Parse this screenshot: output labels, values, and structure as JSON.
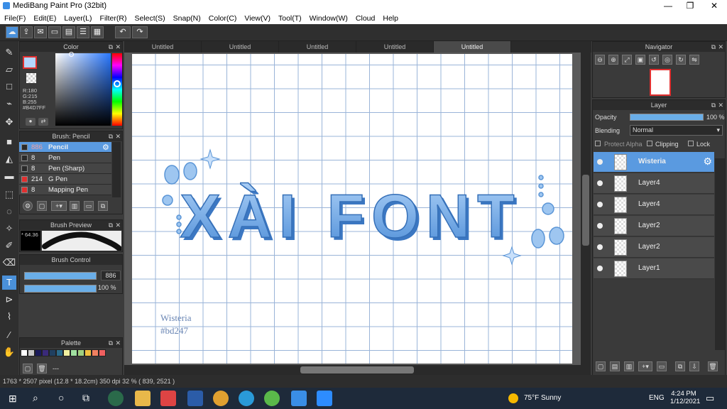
{
  "app": {
    "title": "MediBang Paint Pro (32bit)"
  },
  "window_controls": [
    "—",
    "❐",
    "✕"
  ],
  "menu": [
    "File(F)",
    "Edit(E)",
    "Layer(L)",
    "Filter(R)",
    "Select(S)",
    "Snap(N)",
    "Color(C)",
    "View(V)",
    "Tool(T)",
    "Window(W)",
    "Cloud",
    "Help"
  ],
  "tabs": [
    {
      "label": "Untitled"
    },
    {
      "label": "Untitled"
    },
    {
      "label": "Untitled"
    },
    {
      "label": "Untitled"
    },
    {
      "label": "Untitled",
      "active": true
    }
  ],
  "color_panel": {
    "title": "Color",
    "r": "R:180",
    "g": "G:215",
    "b": "B:255",
    "hex": "#B4D7FF",
    "fg": "#B4D7FF"
  },
  "brush_panel": {
    "title": "Brush: Pencil",
    "items": [
      {
        "size": "886",
        "name": "Pencil",
        "selected": true,
        "swatch": "#2a2a2a"
      },
      {
        "size": "8",
        "name": "Pen",
        "swatch": "#2a2a2a"
      },
      {
        "size": "8",
        "name": "Pen (Sharp)",
        "swatch": "#2a2a2a"
      },
      {
        "size": "214",
        "name": "G Pen",
        "swatch": "#e03030"
      },
      {
        "size": "8",
        "name": "Mapping Pen",
        "swatch": "#e03030"
      }
    ]
  },
  "brush_preview": {
    "title": "Brush Preview",
    "size_label": "* 64.36"
  },
  "brush_control": {
    "title": "Brush Control",
    "size": "886",
    "opacity": "100 %"
  },
  "palette": {
    "title": "Palette",
    "extra": "---",
    "colors": [
      "#ffffff",
      "#c8c8c8",
      "#1a1a5a",
      "#3a2a7a",
      "#204060",
      "#2a6a8a",
      "#f0f0a0",
      "#a0e0a0",
      "#a0d080",
      "#f0c040",
      "#f08060",
      "#f06060"
    ]
  },
  "canvas": {
    "signature_name": "Wisteria",
    "signature_code": "#bd247",
    "art_text": "XÀI FONT"
  },
  "navigator": {
    "title": "Navigator"
  },
  "layer_panel": {
    "title": "Layer",
    "opacity_label": "Opacity",
    "opacity_value": "100 %",
    "blending_label": "Blending",
    "blending_value": "Normal",
    "protect_alpha": "Protect Alpha",
    "clipping": "Clipping",
    "lock": "Lock",
    "layers": [
      {
        "name": "Wisteria",
        "selected": true
      },
      {
        "name": "Layer4"
      },
      {
        "name": "Layer4"
      },
      {
        "name": "Layer2"
      },
      {
        "name": "Layer2"
      },
      {
        "name": "Layer1"
      }
    ]
  },
  "status": {
    "text": "1763 * 2507 pixel  (12.8 * 18.2cm)  350 dpi  32 %  ( 839, 2521 )"
  },
  "taskbar": {
    "weather": "75°F  Sunny",
    "lang": "ENG",
    "time": "4:24 PM",
    "date": "1/12/2021"
  }
}
